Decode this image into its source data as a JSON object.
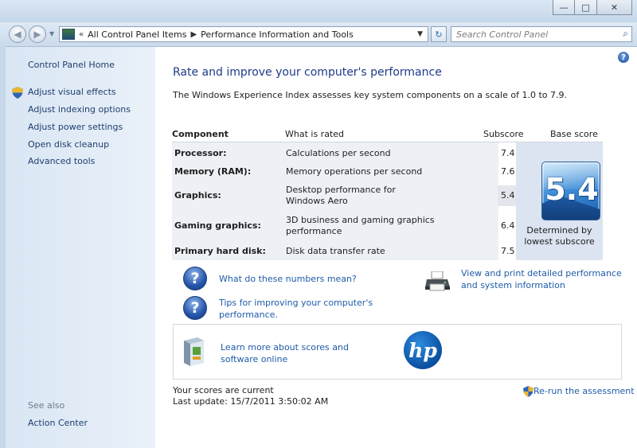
{
  "window": {
    "minimize": "—",
    "maximize": "□",
    "close": "✕"
  },
  "address": {
    "overflow": "«",
    "crumbs": [
      "All Control Panel Items",
      "Performance Information and Tools"
    ],
    "search_placeholder": "Search Control Panel"
  },
  "sidebar": {
    "home": "Control Panel Home",
    "items": [
      "Adjust visual effects",
      "Adjust indexing options",
      "Adjust power settings",
      "Open disk cleanup",
      "Advanced tools"
    ],
    "see_also_label": "See also",
    "see_also_items": [
      "Action Center"
    ]
  },
  "main": {
    "title": "Rate and improve your computer's performance",
    "intro": "The Windows Experience Index assesses key system components on a scale of 1.0 to 7.9.",
    "headers": {
      "component": "Component",
      "what": "What is rated",
      "subscore": "Subscore",
      "base": "Base score"
    },
    "rows": [
      {
        "component": "Processor:",
        "what": "Calculations per second",
        "subscore": "7.4"
      },
      {
        "component": "Memory (RAM):",
        "what": "Memory operations per second",
        "subscore": "7.6"
      },
      {
        "component": "Graphics:",
        "what": "Desktop performance for Windows Aero",
        "subscore": "5.4"
      },
      {
        "component": "Gaming graphics:",
        "what": "3D business and gaming graphics performance",
        "subscore": "6.4"
      },
      {
        "component": "Primary hard disk:",
        "what": "Disk data transfer rate",
        "subscore": "7.5"
      }
    ],
    "base_score": "5.4",
    "base_caption": "Determined by lowest subscore",
    "links": {
      "numbers": "What do these numbers mean?",
      "tips": "Tips for improving your computer's performance.",
      "print": "View and print detailed performance and system information",
      "learn": "Learn more about scores and software online"
    },
    "hp_logo": "hp",
    "status_line1": "Your scores are current",
    "status_line2": "Last update: 15/7/2011 3:50:02 AM",
    "rerun": "Re-run the assessment"
  },
  "colors": {
    "link": "#1e5ca8",
    "title": "#1e3a8a",
    "badge": "#3d8ed8"
  },
  "icons": [
    "back-icon",
    "forward-icon",
    "control-panel-icon",
    "refresh-icon",
    "search-icon",
    "help-icon",
    "shield-icon",
    "question-icon",
    "printer-icon",
    "software-box-icon",
    "hp-logo"
  ]
}
